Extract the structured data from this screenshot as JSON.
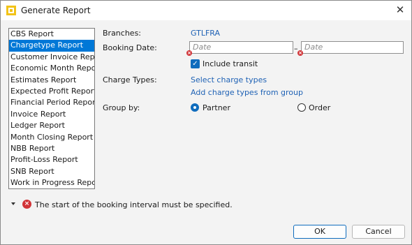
{
  "window": {
    "title": "Generate Report",
    "close_glyph": "✕",
    "icon": "report-app-icon"
  },
  "reports": {
    "items": [
      "CBS Report",
      "Chargetype Report",
      "Customer Invoice Report",
      "Economic Month Report",
      "Estimates Report",
      "Expected Profit Report",
      "Financial Period Report",
      "Invoice Report",
      "Ledger Report",
      "Month Closing Report",
      "NBB Report",
      "Profit-Loss Report",
      "SNB Report",
      "Work in Progress Report"
    ],
    "selected_index": 1
  },
  "form": {
    "branches_label": "Branches:",
    "branches_value": "GTLFRA",
    "booking_date_label": "Booking Date:",
    "date_from_placeholder": "Date",
    "date_to_placeholder": "Date",
    "date_separator": "–",
    "include_transit_label": "Include transit",
    "include_transit_checked": true,
    "charge_types_label": "Charge Types:",
    "select_charge_types_link": "Select charge types",
    "add_from_group_link": "Add charge types from group",
    "group_by_label": "Group by:",
    "group_options": [
      "Partner",
      "Order"
    ],
    "group_selected": "Partner"
  },
  "validation": {
    "message": "The start of the booking interval must be specified.",
    "error_color": "#d13438"
  },
  "buttons": {
    "ok": "OK",
    "cancel": "Cancel"
  },
  "colors": {
    "accent": "#0f6cbd",
    "selection": "#0078d7",
    "link": "#1f62b5"
  }
}
